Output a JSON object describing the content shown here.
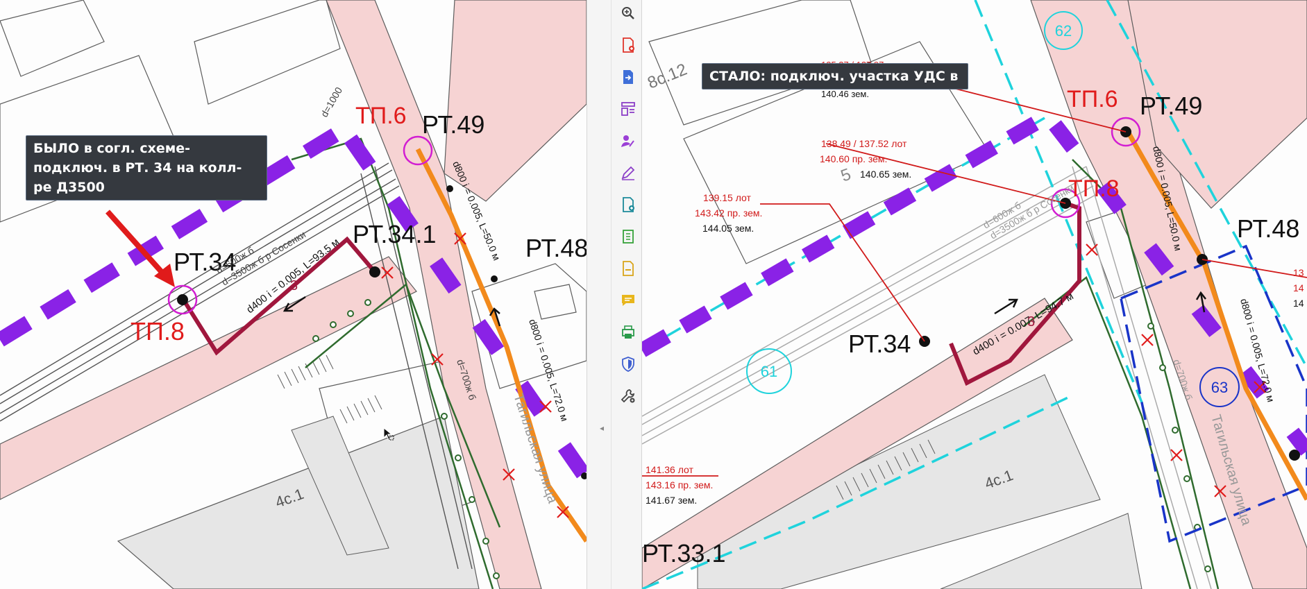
{
  "left_view": {
    "tooltip": "БЫЛО в согл. схеме-подключ. в РТ. 34 на колл-ре Д3500",
    "labels": {
      "pt34": "РТ.34",
      "pt34_1": "РТ.34.1",
      "pt49": "РТ.49",
      "pt48": "РТ.48",
      "tp6": "ТП.6",
      "tp8": "ТП.8",
      "pipe_main": "d400 i = 0.005, L=93.5 м",
      "pipe_d800_top": "d800 i = 0.005, L=50.0 м",
      "pipe_d800_low": "d800 i = 0.005, L=72.0 м",
      "pipe_600x6_a": "d=600ж б",
      "pipe_600x6_b": "d=600ж б",
      "pipe_600x6_c": "d=600ж б",
      "pipe_3500": "d=3500ж б р Сосенки",
      "pipe_1000": "d=1000",
      "pipe_700": "d=700ж б",
      "street": "Тагильская улица",
      "building": "4с.1",
      "seg_num": "3"
    }
  },
  "right_view": {
    "tooltip": "СТАЛО: подключ. участка УДС в",
    "labels": {
      "pt34": "РТ.34",
      "pt49": "РТ.49",
      "pt48": "РТ.48",
      "pt33_1": "РТ.33.1",
      "tp6": "ТП.6",
      "tp8": "ТП.8",
      "pipe_main": "d400 i = 0.007, L=94.7 м",
      "pipe_d800_top": "d800 i = 0.005, L=50.0 м",
      "pipe_d800_low": "d800 i = 0.005, L=72.0 м",
      "pipe_600x6": "d=600ж б",
      "pipe_3500": "d=3500ж б р Сосенки",
      "pipe_700": "d=700ж б",
      "street": "Тагильская улица",
      "building_a": "8с.12",
      "building_b": "4с.1",
      "area_num": "5",
      "circle_62": "62",
      "circle_61": "61",
      "circle_63": "63",
      "seg_num": "3"
    },
    "elevations": {
      "a_lot": "135.27 / 137.97 лот",
      "a_zem": "140.46 зем.",
      "b_lot": "138.49 / 137.52  лот",
      "b_pr": "140.60 пр. зем.",
      "b_zem": "140.65 зем.",
      "c_lot": "139.15  лот",
      "c_pr": "143.42 пр. зем.",
      "c_zem": "144.05 зем.",
      "d_lot": "141.36  лот",
      "d_pr": "143.16 пр. зем.",
      "d_zem": "141.67 зем.",
      "edge_1": "13",
      "edge_2": "14",
      "edge_3": "14"
    }
  },
  "sidebar": {
    "tools": [
      {
        "name": "zoom-icon",
        "label": "Увеличить"
      },
      {
        "name": "create-pdf-icon",
        "label": "Создать PDF"
      },
      {
        "name": "export-pdf-icon",
        "label": "Экспорт PDF"
      },
      {
        "name": "organize-pages-icon",
        "label": "Систематизировать страницы"
      },
      {
        "name": "fill-sign-icon",
        "label": "Заполнить и подписать"
      },
      {
        "name": "edit-pdf-icon",
        "label": "Редактировать PDF"
      },
      {
        "name": "combine-files-icon",
        "label": "Объединить файлы"
      },
      {
        "name": "compress-icon",
        "label": "Сжать PDF"
      },
      {
        "name": "send-review-icon",
        "label": "Отправить на рецензию"
      },
      {
        "name": "comment-icon",
        "label": "Комментарий"
      },
      {
        "name": "print-production-icon",
        "label": "Печать"
      },
      {
        "name": "protect-icon",
        "label": "Защитить"
      },
      {
        "name": "more-tools-icon",
        "label": "Другие инструменты"
      }
    ]
  },
  "colors": {
    "road": "#f6d3d3",
    "sewer": "#a0173d",
    "drain": "#f28a1c",
    "violet": "#8a22e6",
    "cyan": "#1fd3dc",
    "blue": "#1934c8",
    "green": "#2f6b2e",
    "red": "#e01b1b",
    "magenta": "#d21ed2"
  }
}
